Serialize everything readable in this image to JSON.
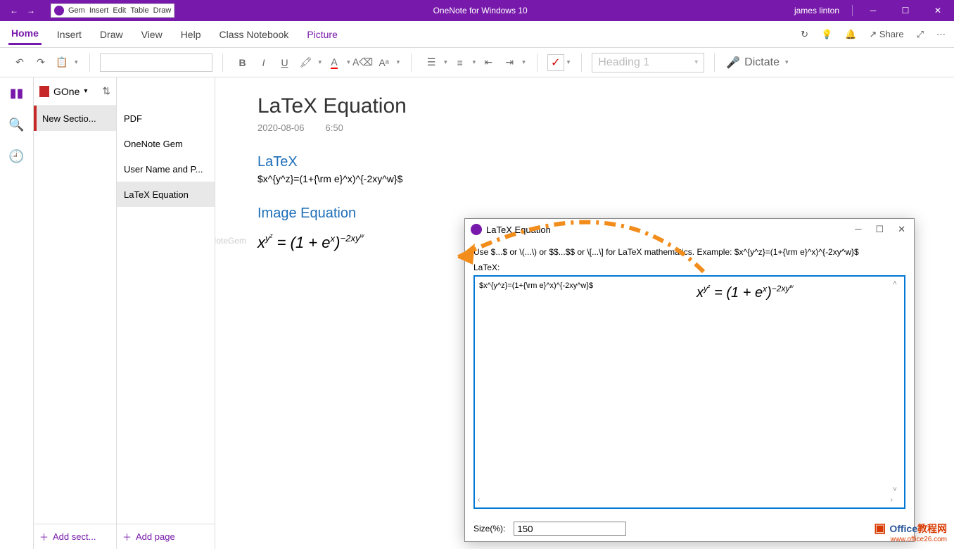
{
  "titlebar": {
    "app_title": "OneNote for Windows 10",
    "user": "james linton",
    "gem_menu": [
      "Gem",
      "Insert",
      "Edit",
      "Table",
      "Draw"
    ]
  },
  "menu_tabs": [
    "Home",
    "Insert",
    "Draw",
    "View",
    "Help",
    "Class Notebook",
    "Picture"
  ],
  "menu_right": {
    "share": "Share"
  },
  "toolbar": {
    "heading_placeholder": "Heading 1",
    "dictate": "Dictate"
  },
  "notebook": {
    "name": "GOne",
    "section": "New Sectio...",
    "add_section": "Add sect...",
    "add_page": "Add page"
  },
  "pages": [
    "PDF",
    "OneNote Gem",
    "User Name and P...",
    "LaTeX Equation"
  ],
  "page": {
    "title": "LaTeX Equation",
    "date": "2020-08-06",
    "time": "6:50",
    "h_latex": "LaTeX",
    "latex_src": "$x^{y^z}=(1+{\\rm e}^x)^{-2xy^w}$",
    "h_img": "Image Equation",
    "watermark": "OneNoteGem"
  },
  "equation_html": "<i>x</i><sup><i>y</i><sup><i>z</i></sup></sup> = (1 + e<sup><i>x</i></sup>)<sup>−2<i>xy</i><sup><i>w</i></sup></sup>",
  "dialog": {
    "title": "LaTeX Equation",
    "hint": "Use $...$ or \\(...\\) or $$...$$ or \\[...\\] for LaTeX mathematics. Example: $x^{y^z}=(1+{\\rm e}^x)^{-2xy^w}$",
    "label": "LaTeX:",
    "textarea": "$x^{y^z}=(1+{\\rm e}^x)^{-2xy^w}$",
    "size_label": "Size(%):",
    "size_value": "150"
  },
  "corner": {
    "brand": "Office教程网",
    "url": "www.office26.com"
  }
}
